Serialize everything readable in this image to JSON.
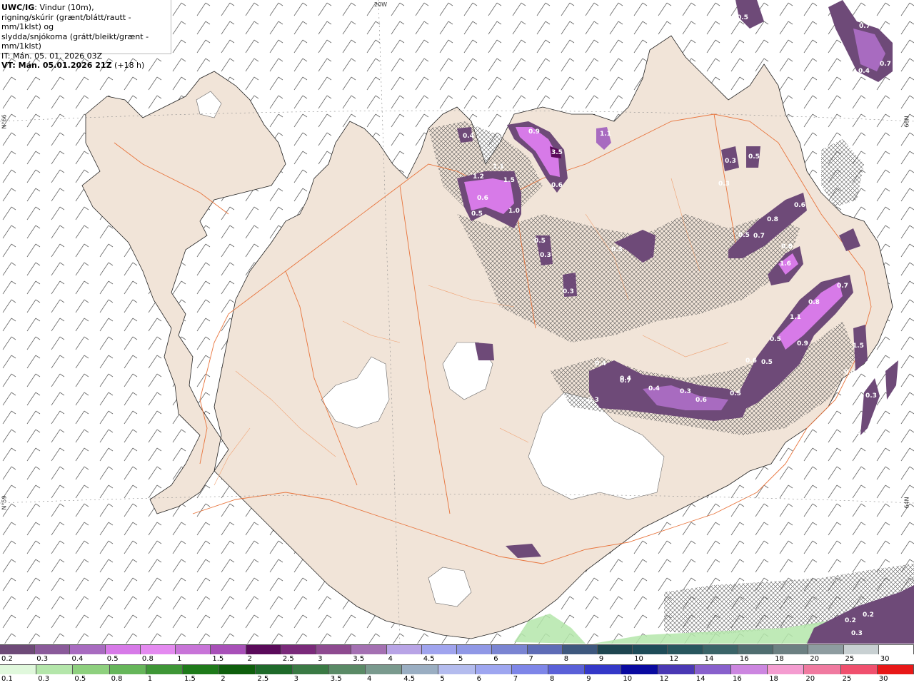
{
  "header": {
    "product": "UWC/IG",
    "line1_rest": ": Vindur (10m),",
    "line2": "rigning/skúrir (grænt/blátt/rautt - mm/1klst) og",
    "line3": "slydda/snjókoma (grátt/bleikt/grænt - mm/1klst)",
    "line4": "IT: Mán. 05. 01. 2026 03Z",
    "line5_bold": "VT: Mán. 05.01.2026 21Z",
    "line5_rest": " (+18 h)"
  },
  "graticule": {
    "lon_top": "20W",
    "lat_left_upper": "N°66",
    "lat_left_lower": "N°59",
    "lat_right_upper": "66N",
    "lat_right_lower": "64N"
  },
  "snow_legend": {
    "labels": [
      "0.2",
      "0.3",
      "0.4",
      "0.5",
      "0.8",
      "1",
      "1.5",
      "2",
      "2.5",
      "3",
      "3.5",
      "4",
      "4.5",
      "5",
      "6",
      "7",
      "8",
      "9",
      "10",
      "12",
      "14",
      "16",
      "18",
      "20",
      "25",
      "30"
    ],
    "colors": [
      "#6e4a78",
      "#8a5a9a",
      "#a86bc0",
      "#d77ae8",
      "#e48af0",
      "#c874d8",
      "#a850b8",
      "#5a0a5a",
      "#7a2a7a",
      "#8e4a90",
      "#a470b2",
      "#b8a4e6",
      "#a0a4ee",
      "#9098e6",
      "#7a84d2",
      "#5e6cb6",
      "#3e587e",
      "#1e4650",
      "#1e4c58",
      "#28565e",
      "#3a6468",
      "#506e70",
      "#6c8082",
      "#8e9ca0",
      "#c8d0d2",
      "#ffffff"
    ]
  },
  "rain_legend": {
    "labels": [
      "0.1",
      "0.3",
      "0.5",
      "0.8",
      "1",
      "1.5",
      "2",
      "2.5",
      "3",
      "3.5",
      "4",
      "4.5",
      "5",
      "6",
      "7",
      "8",
      "9",
      "10",
      "12",
      "14",
      "16",
      "18",
      "20",
      "25",
      "30"
    ],
    "colors": [
      "#e0f8dc",
      "#b4e6aa",
      "#8ed07e",
      "#66b65a",
      "#3e9636",
      "#1e7a1a",
      "#0e5e0c",
      "#1e6a2a",
      "#3a7a44",
      "#5a8a66",
      "#7a9a8e",
      "#9aaec2",
      "#b4bcee",
      "#9ea6f0",
      "#7e86e8",
      "#5a60d8",
      "#3438c8",
      "#0a0aa0",
      "#4a38b4",
      "#8860cc",
      "#cc86e0",
      "#f49cd0",
      "#f07aa0",
      "#f0506e",
      "#e81818"
    ]
  },
  "precip_labels": [
    {
      "v": "0.4"
    },
    {
      "v": "1.2"
    },
    {
      "v": "1.1"
    },
    {
      "v": "1.5"
    },
    {
      "v": "0.6"
    },
    {
      "v": "0.5"
    },
    {
      "v": "1.0"
    },
    {
      "v": "0.9"
    },
    {
      "v": "3.5"
    },
    {
      "v": "0.6"
    },
    {
      "v": "1.1"
    },
    {
      "v": "0.3"
    },
    {
      "v": "0.5"
    },
    {
      "v": "0.3"
    },
    {
      "v": "0.5"
    },
    {
      "v": "0.3"
    },
    {
      "v": "0.3"
    },
    {
      "v": "0.3"
    },
    {
      "v": "0.5"
    },
    {
      "v": "0.7"
    },
    {
      "v": "0.8"
    },
    {
      "v": "0.6"
    },
    {
      "v": "0.8"
    },
    {
      "v": "1.6"
    },
    {
      "v": "0.7"
    },
    {
      "v": "0.8"
    },
    {
      "v": "1.1"
    },
    {
      "v": "0.9"
    },
    {
      "v": "0.5"
    },
    {
      "v": "0.5"
    },
    {
      "v": "0.6"
    },
    {
      "v": "1.5"
    },
    {
      "v": "0.4"
    },
    {
      "v": "0.3"
    },
    {
      "v": "0.3"
    },
    {
      "v": "0.4"
    },
    {
      "v": "0.7"
    },
    {
      "v": "0.4"
    },
    {
      "v": "0.3"
    },
    {
      "v": "0.6"
    },
    {
      "v": "0.5"
    },
    {
      "v": "0.3"
    },
    {
      "v": "0.4"
    },
    {
      "v": "0.7"
    },
    {
      "v": "0.7"
    },
    {
      "v": "0.4"
    },
    {
      "v": "0.5"
    },
    {
      "v": "0.2"
    },
    {
      "v": "0.2"
    },
    {
      "v": "0.3"
    },
    {
      "v": "0.5"
    }
  ]
}
